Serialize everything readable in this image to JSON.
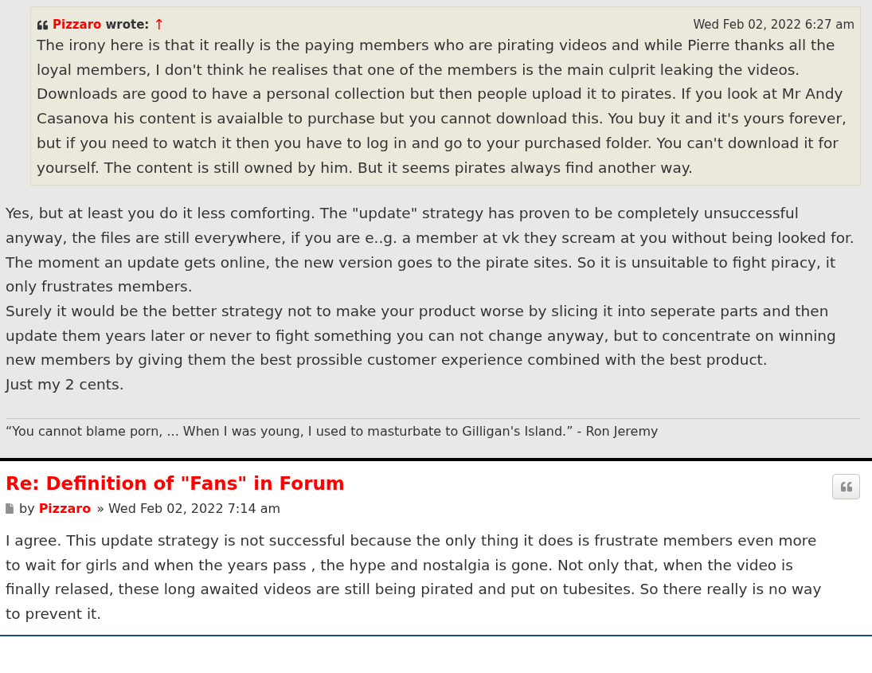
{
  "quoted_post": {
    "quote": {
      "author": "Pizzaro",
      "wrote_label": "wrote:",
      "jump_arrow": "↑",
      "date": "Wed Feb 02, 2022 6:27 am",
      "text": "The irony here is that it really is the paying members who are pirating videos and while Pierre thanks all the loyal members, I don't think he realises that one of the members is the main culprit leaking the videos. Downloads are good to have a personal collection but then people upload it to pirates. If you look at Mr Andy Casanova his content is avaialble to purchase but you cannot download this. You buy it and it's yours forever, but if you need to watch it then you have to log in and go to your purchased folder. You can't download it for yourself. The content is still owned by him. But it seems pirates always find another way."
    },
    "paragraphs": [
      "Yes, but at least you do it less comforting. The \"update\" strategy has proven to be completely unsuccessful anyway, the files are still everywhere, if you are e..g. a member at vk they scream at you without being looked for. The moment an update gets online, the new version goes to the pirate sites. So it is unsuitable to fight piracy, it only frustrates members.",
      "Surely it would be the better strategy not to make your product worse by slicing it into seperate parts and then update them years later or never to fight something you can not change anyway, but to concentrate on winning new members by giving them the best prossible customer experience combined with the best product.",
      "Just my 2 cents."
    ],
    "signature": "“You cannot blame porn, ... When I was young, I used to masturbate to Gilligan's Island.” - Ron Jeremy"
  },
  "post": {
    "title": "Re: Definition of \"Fans\" in Forum",
    "by_label": "by",
    "author": "Pizzaro",
    "separator": "»",
    "date": "Wed Feb 02, 2022 7:14 am",
    "text": "I agree. This update strategy is not successful because the only thing it does is frustrate members even more to wait for girls and when the years pass , the hype and nostalgia is gone. Not only that, when the video is finally relased, these long awaited videos are still being pirated and put on tubesites. So there really is no way to prevent it."
  }
}
